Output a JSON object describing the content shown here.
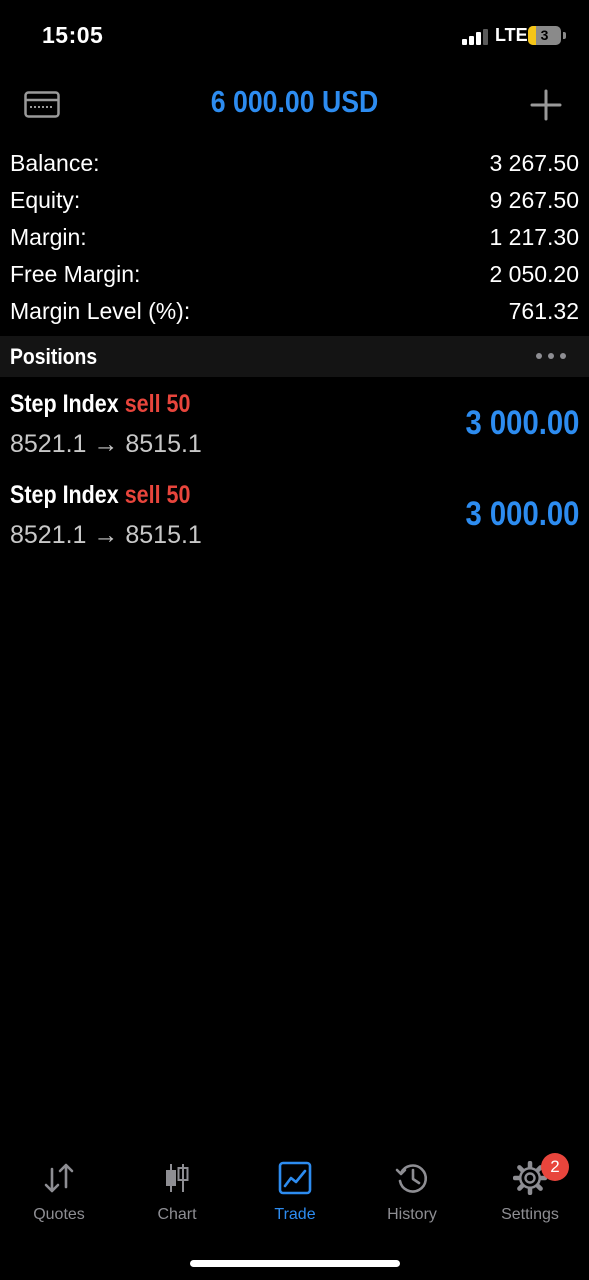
{
  "status": {
    "time": "15:05",
    "network": "LTE",
    "battery_level": "3",
    "battery_color": "#f5c518"
  },
  "header": {
    "balance": "6 000.00 USD",
    "left_icon": "card-icon",
    "right_icon": "plus-icon"
  },
  "summary": {
    "rows": [
      {
        "label": "Balance:",
        "value": "3 267.50"
      },
      {
        "label": "Equity:",
        "value": "9 267.50"
      },
      {
        "label": "Margin:",
        "value": "1 217.30"
      },
      {
        "label": "Free Margin:",
        "value": "2 050.20"
      },
      {
        "label": "Margin Level (%):",
        "value": "761.32"
      }
    ]
  },
  "positions": {
    "title": "Positions",
    "items": [
      {
        "symbol": "Step Index",
        "side": "sell 50",
        "prices": "8521.1 → 8515.1",
        "profit": "3 000.00"
      },
      {
        "symbol": "Step Index",
        "side": "sell 50",
        "prices": "8521.1 → 8515.1",
        "profit": "3 000.00"
      }
    ]
  },
  "tabs": [
    {
      "label": "Quotes",
      "icon": "quotes-icon"
    },
    {
      "label": "Chart",
      "icon": "chart-icon"
    },
    {
      "label": "Trade",
      "icon": "trade-icon",
      "active": true
    },
    {
      "label": "History",
      "icon": "history-icon"
    },
    {
      "label": "Settings",
      "icon": "settings-icon"
    }
  ],
  "settings_badge": "2",
  "colors": {
    "accent": "#2d8cf0",
    "sell": "#e8453c",
    "background": "#000000"
  }
}
